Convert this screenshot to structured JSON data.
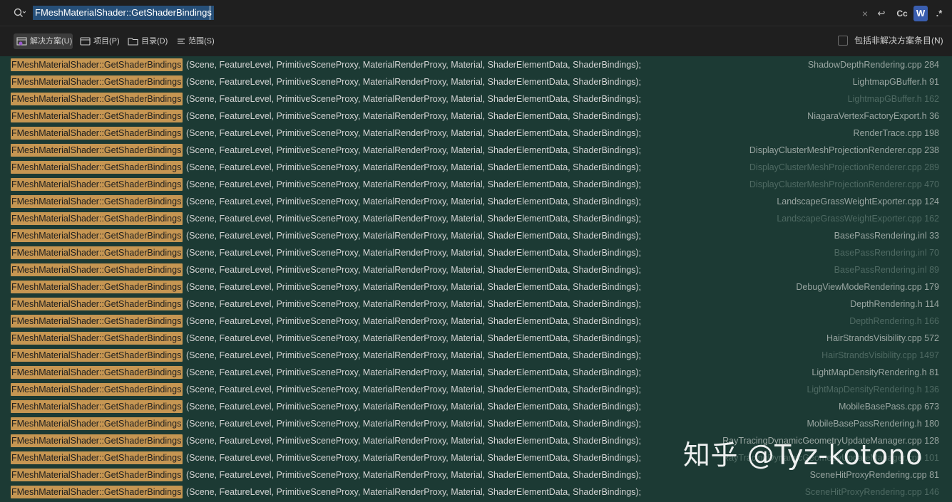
{
  "search": {
    "query": "FMeshMaterialShader::GetShaderBindings",
    "clear_glyph": "×",
    "enter_glyph": "↩",
    "match_case_label": "Cc",
    "whole_word_label": "W",
    "regex_label": ".*"
  },
  "scope": {
    "solution_label": "解决方案(U)",
    "project_label": "项目(P)",
    "directory_label": "目录(D)",
    "scope_label": "范围(S)",
    "include_external_label": "包括非解决方案条目(N)"
  },
  "colors": {
    "results_bg": "#1c3a34",
    "match_highlight": "#c69652",
    "whole_word_active": "#3a5eaf"
  },
  "results": [
    {
      "match": "FMeshMaterialShader::GetShaderBindings",
      "args": "(Scene, FeatureLevel, PrimitiveSceneProxy, MaterialRenderProxy, Material, ShaderElementData, ShaderBindings);",
      "location": "ShadowDepthRendering.cpp 284",
      "dim": false
    },
    {
      "match": "FMeshMaterialShader::GetShaderBindings",
      "args": "(Scene, FeatureLevel, PrimitiveSceneProxy, MaterialRenderProxy, Material, ShaderElementData, ShaderBindings);",
      "location": "LightmapGBuffer.h 91",
      "dim": false
    },
    {
      "match": "FMeshMaterialShader::GetShaderBindings",
      "args": "(Scene, FeatureLevel, PrimitiveSceneProxy, MaterialRenderProxy, Material, ShaderElementData, ShaderBindings);",
      "location": "LightmapGBuffer.h 162",
      "dim": true
    },
    {
      "match": "FMeshMaterialShader::GetShaderBindings",
      "args": "(Scene, FeatureLevel, PrimitiveSceneProxy, MaterialRenderProxy, Material, ShaderElementData, ShaderBindings);",
      "location": "NiagaraVertexFactoryExport.h 36",
      "dim": false
    },
    {
      "match": "FMeshMaterialShader::GetShaderBindings",
      "args": "(Scene, FeatureLevel, PrimitiveSceneProxy, MaterialRenderProxy, Material, ShaderElementData, ShaderBindings);",
      "location": "RenderTrace.cpp 198",
      "dim": false
    },
    {
      "match": "FMeshMaterialShader::GetShaderBindings",
      "args": "(Scene, FeatureLevel, PrimitiveSceneProxy, MaterialRenderProxy, Material, ShaderElementData, ShaderBindings);",
      "location": "DisplayClusterMeshProjectionRenderer.cpp 238",
      "dim": false
    },
    {
      "match": "FMeshMaterialShader::GetShaderBindings",
      "args": "(Scene, FeatureLevel, PrimitiveSceneProxy, MaterialRenderProxy, Material, ShaderElementData, ShaderBindings);",
      "location": "DisplayClusterMeshProjectionRenderer.cpp 289",
      "dim": true
    },
    {
      "match": "FMeshMaterialShader::GetShaderBindings",
      "args": "(Scene, FeatureLevel, PrimitiveSceneProxy, MaterialRenderProxy, Material, ShaderElementData, ShaderBindings);",
      "location": "DisplayClusterMeshProjectionRenderer.cpp 470",
      "dim": true
    },
    {
      "match": "FMeshMaterialShader::GetShaderBindings",
      "args": "(Scene, FeatureLevel, PrimitiveSceneProxy, MaterialRenderProxy, Material, ShaderElementData, ShaderBindings);",
      "location": "LandscapeGrassWeightExporter.cpp 124",
      "dim": false
    },
    {
      "match": "FMeshMaterialShader::GetShaderBindings",
      "args": "(Scene, FeatureLevel, PrimitiveSceneProxy, MaterialRenderProxy, Material, ShaderElementData, ShaderBindings);",
      "location": "LandscapeGrassWeightExporter.cpp 162",
      "dim": true
    },
    {
      "match": "FMeshMaterialShader::GetShaderBindings",
      "args": "(Scene, FeatureLevel, PrimitiveSceneProxy, MaterialRenderProxy, Material, ShaderElementData, ShaderBindings);",
      "location": "BasePassRendering.inl 33",
      "dim": false
    },
    {
      "match": "FMeshMaterialShader::GetShaderBindings",
      "args": "(Scene, FeatureLevel, PrimitiveSceneProxy, MaterialRenderProxy, Material, ShaderElementData, ShaderBindings);",
      "location": "BasePassRendering.inl 70",
      "dim": true
    },
    {
      "match": "FMeshMaterialShader::GetShaderBindings",
      "args": "(Scene, FeatureLevel, PrimitiveSceneProxy, MaterialRenderProxy, Material, ShaderElementData, ShaderBindings);",
      "location": "BasePassRendering.inl 89",
      "dim": true
    },
    {
      "match": "FMeshMaterialShader::GetShaderBindings",
      "args": "(Scene, FeatureLevel, PrimitiveSceneProxy, MaterialRenderProxy, Material, ShaderElementData, ShaderBindings);",
      "location": "DebugViewModeRendering.cpp 179",
      "dim": false
    },
    {
      "match": "FMeshMaterialShader::GetShaderBindings",
      "args": "(Scene, FeatureLevel, PrimitiveSceneProxy, MaterialRenderProxy, Material, ShaderElementData, ShaderBindings);",
      "location": "DepthRendering.h 114",
      "dim": false
    },
    {
      "match": "FMeshMaterialShader::GetShaderBindings",
      "args": "(Scene, FeatureLevel, PrimitiveSceneProxy, MaterialRenderProxy, Material, ShaderElementData, ShaderBindings);",
      "location": "DepthRendering.h 166",
      "dim": true
    },
    {
      "match": "FMeshMaterialShader::GetShaderBindings",
      "args": "(Scene, FeatureLevel, PrimitiveSceneProxy, MaterialRenderProxy, Material, ShaderElementData, ShaderBindings);",
      "location": "HairStrandsVisibility.cpp 572",
      "dim": false
    },
    {
      "match": "FMeshMaterialShader::GetShaderBindings",
      "args": "(Scene, FeatureLevel, PrimitiveSceneProxy, MaterialRenderProxy, Material, ShaderElementData, ShaderBindings);",
      "location": "HairStrandsVisibility.cpp 1497",
      "dim": true
    },
    {
      "match": "FMeshMaterialShader::GetShaderBindings",
      "args": "(Scene, FeatureLevel, PrimitiveSceneProxy, MaterialRenderProxy, Material, ShaderElementData, ShaderBindings);",
      "location": "LightMapDensityRendering.h 81",
      "dim": false
    },
    {
      "match": "FMeshMaterialShader::GetShaderBindings",
      "args": "(Scene, FeatureLevel, PrimitiveSceneProxy, MaterialRenderProxy, Material, ShaderElementData, ShaderBindings);",
      "location": "LightMapDensityRendering.h 136",
      "dim": true
    },
    {
      "match": "FMeshMaterialShader::GetShaderBindings",
      "args": "(Scene, FeatureLevel, PrimitiveSceneProxy, MaterialRenderProxy, Material, ShaderElementData, ShaderBindings);",
      "location": "MobileBasePass.cpp 673",
      "dim": false
    },
    {
      "match": "FMeshMaterialShader::GetShaderBindings",
      "args": "(Scene, FeatureLevel, PrimitiveSceneProxy, MaterialRenderProxy, Material, ShaderElementData, ShaderBindings);",
      "location": "MobileBasePassRendering.h 180",
      "dim": false
    },
    {
      "match": "FMeshMaterialShader::GetShaderBindings",
      "args": "(Scene, FeatureLevel, PrimitiveSceneProxy, MaterialRenderProxy, Material, ShaderElementData, ShaderBindings);",
      "location": "RayTracingDynamicGeometryUpdateManager.cpp 128",
      "dim": false
    },
    {
      "match": "FMeshMaterialShader::GetShaderBindings",
      "args": "(Scene, FeatureLevel, PrimitiveSceneProxy, MaterialRenderProxy, Material, ShaderElementData, ShaderBindings);",
      "location": "RayTracingDynamicGeometryUpdateManager.cpp 101",
      "dim": true
    },
    {
      "match": "FMeshMaterialShader::GetShaderBindings",
      "args": "(Scene, FeatureLevel, PrimitiveSceneProxy, MaterialRenderProxy, Material, ShaderElementData, ShaderBindings);",
      "location": "SceneHitProxyRendering.cpp 81",
      "dim": false
    },
    {
      "match": "FMeshMaterialShader::GetShaderBindings",
      "args": "(Scene, FeatureLevel, PrimitiveSceneProxy, MaterialRenderProxy, Material, ShaderElementData, ShaderBindings);",
      "location": "SceneHitProxyRendering.cpp 146",
      "dim": true
    }
  ],
  "watermark": "知乎 @Tyz-kotono"
}
